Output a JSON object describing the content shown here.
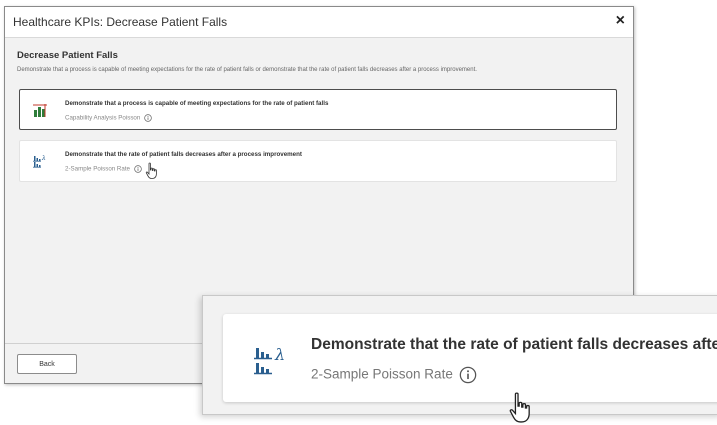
{
  "dialog": {
    "title": "Healthcare KPIs: Decrease Patient Falls",
    "close_glyph": "×",
    "heading": "Decrease Patient Falls",
    "description": "Demonstrate that a process is capable of meeting expectations for the rate of patient falls or demonstrate that the rate of patient falls decreases after a process improvement.",
    "cards": [
      {
        "title": "Demonstrate that a process is capable of meeting expectations for the rate of patient falls",
        "subtitle": "Capability Analysis Poisson",
        "icon": "capability-chart-icon",
        "selected": true
      },
      {
        "title": "Demonstrate that the rate of patient falls decreases after a process improvement",
        "subtitle": "2-Sample Poisson Rate",
        "icon": "poisson-rate-icon",
        "selected": false
      }
    ],
    "back_label": "Back"
  },
  "zoom": {
    "title": "Demonstrate that the rate of patient falls decreases afte",
    "subtitle": "2-Sample Poisson Rate",
    "icon": "poisson-rate-icon"
  },
  "colors": {
    "accent_green": "#2e7d3a",
    "accent_red": "#c0392b",
    "icon_blue": "#2a5f8f",
    "panel_gray": "#f2f2f2"
  }
}
